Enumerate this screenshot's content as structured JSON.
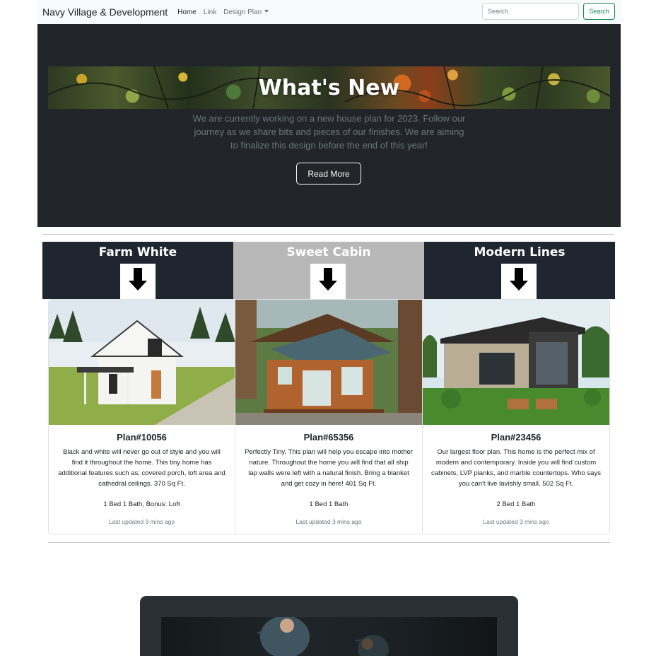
{
  "navbar": {
    "brand": "Navy Village & Development",
    "links": [
      {
        "label": "Home",
        "active": true
      },
      {
        "label": "Link",
        "active": false
      },
      {
        "label": "Design Plan",
        "dropdown": true
      }
    ],
    "search_placeholder": "Search",
    "search_button": "Search"
  },
  "hero": {
    "title": "What's New",
    "text": "We are currently working on a new house plan for 2023. Follow our journey as we share bits and pieces of our finishes. We are aiming to finalize this design before the end of this year!",
    "button": "Read More"
  },
  "plans": [
    {
      "header": "Farm White",
      "header_bg": "#1f2630",
      "title": "Plan#10056",
      "text": "Black and white will never go out of style and you will find it throughout the home. This tiny home has additional features such as; covered porch, loft area and cathedral ceilings. 370 Sq Ft.",
      "beds": "1 Bed 1 Bath, Bonus: Loft",
      "updated": "Last updated 3 mins ago"
    },
    {
      "header": "Sweet Cabin",
      "header_bg": "#b8b8b8",
      "title": "Plan#65356",
      "text": "Perfectly Tiny. This plan will help you escape into mother nature. Throughout the home you will find that all ship lap walls were left with a natural finish. Bring a blanket and get cozy in here! 401 Sq Ft.",
      "beds": "1 Bed 1 Bath",
      "updated": "Last updated 3 mins ago"
    },
    {
      "header": "Modern Lines",
      "header_bg": "#1f2630",
      "title": "Plan#23456",
      "text": "Our largest floor plan. This home is the perfect mix of modern and contemporary. Inside you will find custom cabinets, LVP planks, and marble countertops. Who says you can't live lavishly small. 502 Sq Ft.",
      "beds": "2 Bed 1 Bath",
      "updated": "Last updated 3 mins ago"
    }
  ],
  "colors": {
    "dark": "#212529",
    "navbar_bg": "#f8f9fa",
    "success": "#198754",
    "muted": "#6c757d"
  }
}
